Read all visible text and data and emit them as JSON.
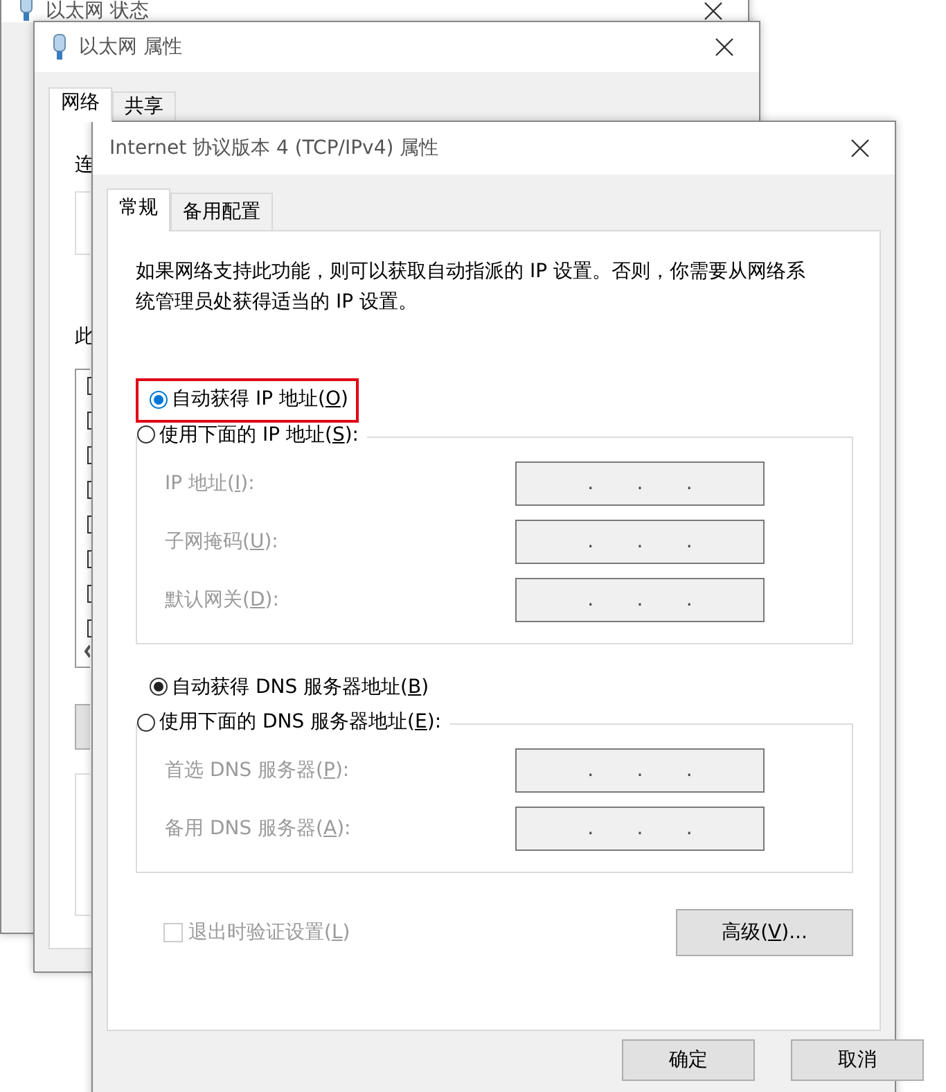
{
  "back_windows": [
    {
      "title": "以太网 状态"
    },
    {
      "title": "以太网 属性",
      "tabs": [
        {
          "label": "网络",
          "selected": true
        },
        {
          "label": "共享",
          "selected": false
        }
      ],
      "fragments": [
        "连",
        "此"
      ]
    }
  ],
  "dialog": {
    "title": "Internet 协议版本 4 (TCP/IPv4) 属性",
    "tabs": [
      {
        "label": "常规",
        "selected": true
      },
      {
        "label": "备用配置",
        "selected": false
      }
    ],
    "description": "如果网络支持此功能，则可以获取自动指派的 IP 设置。否则，你需要从网络系统管理员处获得适当的 IP 设置。",
    "sections": [
      {
        "auto": {
          "label_before": "自动获得 IP 地址(",
          "key": "O",
          "label_after": ")",
          "selected": true,
          "highlighted": true
        },
        "manual": {
          "label_before": "使用下面的 IP 地址(",
          "key": "S",
          "label_after": "):",
          "selected": false
        },
        "fields": [
          {
            "label_before": "IP 地址(",
            "key": "I",
            "label_after": "):",
            "disabled": true,
            "separators": [
              ".",
              ".",
              "."
            ]
          },
          {
            "label_before": "子网掩码(",
            "key": "U",
            "label_after": "):",
            "disabled": true,
            "separators": [
              ".",
              ".",
              "."
            ]
          },
          {
            "label_before": "默认网关(",
            "key": "D",
            "label_after": "):",
            "disabled": true,
            "separators": [
              ".",
              ".",
              "."
            ]
          }
        ]
      },
      {
        "auto": {
          "label_before": "自动获得 DNS 服务器地址(",
          "key": "B",
          "label_after": ")",
          "selected": true,
          "highlighted": false
        },
        "manual": {
          "label_before": "使用下面的 DNS 服务器地址(",
          "key": "E",
          "label_after": "):",
          "selected": false
        },
        "fields": [
          {
            "label_before": "首选 DNS 服务器(",
            "key": "P",
            "label_after": "):",
            "disabled": true,
            "separators": [
              ".",
              ".",
              "."
            ]
          },
          {
            "label_before": "备用 DNS 服务器(",
            "key": "A",
            "label_after": "):",
            "disabled": true,
            "separators": [
              ".",
              ".",
              "."
            ]
          }
        ]
      }
    ],
    "validate": {
      "label_before": "退出时验证设置(",
      "key": "L",
      "label_after": ")",
      "checked": false,
      "disabled": true
    },
    "advanced": {
      "label_before": "高级(",
      "key": "V",
      "label_after": ")..."
    },
    "buttons": [
      "确定",
      "取消"
    ]
  }
}
